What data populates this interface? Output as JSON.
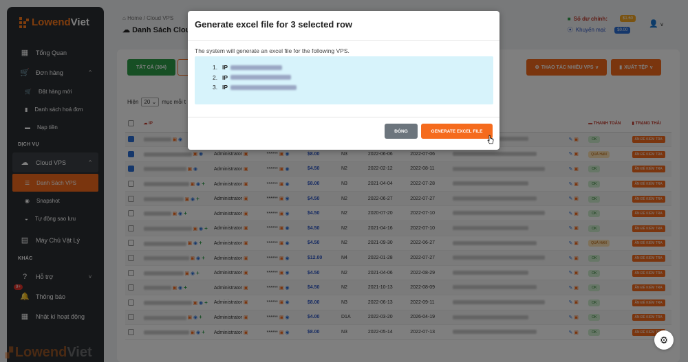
{
  "brand": {
    "name_part1": "Lowend",
    "name_part2": "Viet"
  },
  "sidebar": {
    "items": [
      {
        "label": "Tổng Quan"
      },
      {
        "label": "Đơn hàng"
      },
      {
        "label": "Đặt hàng mới"
      },
      {
        "label": "Danh sách hoá đơn"
      },
      {
        "label": "Nạp tiền"
      }
    ],
    "section_services": "DỊCH VỤ",
    "cloud_vps": "Cloud VPS",
    "cloud_sub": [
      {
        "label": "Danh Sách VPS"
      },
      {
        "label": "Snapshot"
      },
      {
        "label": "Tự động sao lưu"
      }
    ],
    "physical": "Máy Chủ Vật Lý",
    "section_other": "KHÁC",
    "support": "Hỗ trợ",
    "notifications": "Thông báo",
    "notif_count": "9+",
    "activity": "Nhật kí hoạt động"
  },
  "header": {
    "breadcrumb": "Home / Cloud VPS",
    "title": "Danh Sách Cloud V",
    "balance_label": "Số dư chính:",
    "balance_value": "$1.60",
    "promo_label": "Khuyến mại:",
    "promo_value": "$0.00"
  },
  "toolbar": {
    "all_label": "TẤT CẢ (304)",
    "multi_label": "THAO TÁC NHIỀU VPS",
    "export_label": "XUẤT TỆP",
    "show_label": "Hiện",
    "show_value": "20",
    "show_suffix": "mục mỗi t"
  },
  "table": {
    "headers": [
      "IP",
      "THANH TOÁN",
      "TRẠNG THÁI"
    ],
    "rows": [
      {
        "checked": true,
        "user": "",
        "price": "",
        "plan": "",
        "created": "",
        "expire": "",
        "pay": "ok"
      },
      {
        "checked": true,
        "user": "Administrator",
        "price": "$8.00",
        "plan": "N3",
        "created": "2022-06-06",
        "expire": "2022-07-06",
        "pay": "qh"
      },
      {
        "checked": true,
        "user": "Administrator",
        "price": "$4.50",
        "plan": "N2",
        "created": "2022-02-12",
        "expire": "2022-08-11",
        "pay": "ok"
      },
      {
        "checked": false,
        "user": "Administrator",
        "price": "$8.00",
        "plan": "N3",
        "created": "2021-04-04",
        "expire": "2022-07-28",
        "pay": "ok"
      },
      {
        "checked": false,
        "user": "Administrator",
        "price": "$4.50",
        "plan": "N2",
        "created": "2022-06-27",
        "expire": "2022-07-27",
        "pay": "ok"
      },
      {
        "checked": false,
        "user": "Administrator",
        "price": "$4.50",
        "plan": "N2",
        "created": "2020-07-20",
        "expire": "2022-07-10",
        "pay": "ok"
      },
      {
        "checked": false,
        "user": "Administrator",
        "price": "$4.50",
        "plan": "N2",
        "created": "2021-04-16",
        "expire": "2022-07-10",
        "pay": "ok"
      },
      {
        "checked": false,
        "user": "Administrator",
        "price": "$4.50",
        "plan": "N2",
        "created": "2021-09-30",
        "expire": "2022-06-27",
        "pay": "qh"
      },
      {
        "checked": false,
        "user": "Administrator",
        "price": "$12.00",
        "plan": "N4",
        "created": "2022-01-28",
        "expire": "2022-07-27",
        "pay": "ok"
      },
      {
        "checked": false,
        "user": "Administrator",
        "price": "$4.50",
        "plan": "N2",
        "created": "2021-04-06",
        "expire": "2022-08-29",
        "pay": "ok"
      },
      {
        "checked": false,
        "user": "Administrator",
        "price": "$4.50",
        "plan": "N2",
        "created": "2021-10-13",
        "expire": "2022-08-09",
        "pay": "ok"
      },
      {
        "checked": false,
        "user": "Administrator",
        "price": "$8.00",
        "plan": "N3",
        "created": "2022-06-13",
        "expire": "2022-09-11",
        "pay": "ok"
      },
      {
        "checked": false,
        "user": "Administrator",
        "price": "$4.00",
        "plan": "D1A",
        "created": "2022-03-20",
        "expire": "2026-04-19",
        "pay": "ok"
      },
      {
        "checked": false,
        "user": "Administrator",
        "price": "$8.00",
        "plan": "N3",
        "created": "2022-05-14",
        "expire": "2022-07-13",
        "pay": "ok"
      }
    ],
    "ok_label": "OK",
    "overdue_label": "QUÁ HẠN",
    "status_label": "ẤN ĐỂ KIỂM TRA"
  },
  "modal": {
    "title": "Generate excel file for 3 selected row",
    "description": "The system will generate an excel file for the following VPS.",
    "ip_prefix": "IP",
    "ip_list": [
      "1.",
      "2.",
      "3."
    ],
    "close_label": "ĐÓNG",
    "generate_label": "GENERATE EXCEL FILE"
  },
  "colors": {
    "accent": "#f56b1d",
    "sidebar_bg": "#2b2e33",
    "success": "#2e9e49"
  }
}
